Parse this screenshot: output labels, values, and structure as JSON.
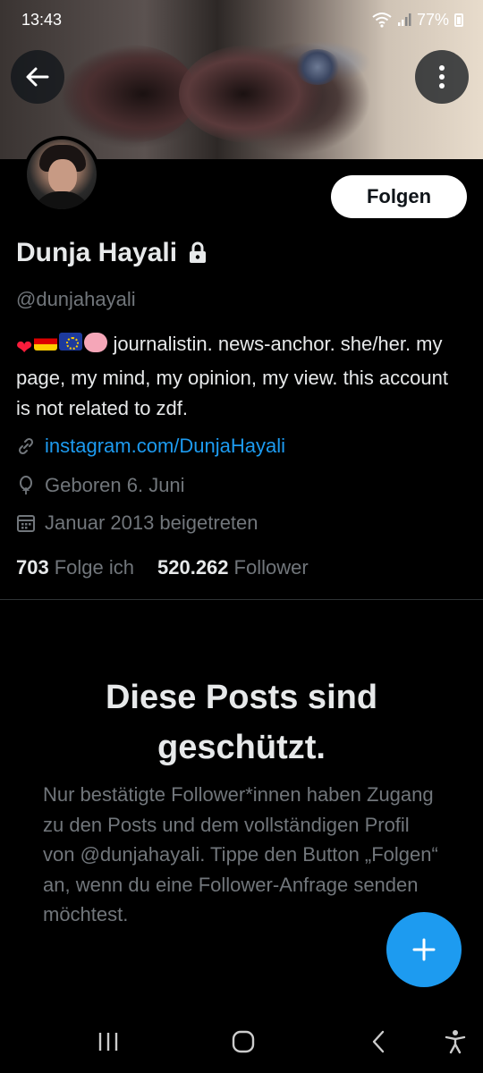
{
  "status_bar": {
    "time": "13:43",
    "battery": "77%",
    "icons": [
      "wifi-icon",
      "signal-icon",
      "battery-icon"
    ]
  },
  "profile": {
    "display_name": "Dunja Hayali",
    "handle": "@dunjahayali",
    "bio_emojis": [
      "heart-emoji",
      "germany-flag-emoji",
      "eu-flag-emoji",
      "brain-emoji"
    ],
    "bio_text": "journalistin. news-anchor. she/her. my page, my mind, my opinion, my view. this account is not related to zdf.",
    "link": "instagram.com/DunjaHayali",
    "birthday": "Geboren 6. Juni",
    "joined": "Januar 2013 beigetreten",
    "following_count": "703",
    "following_label": "Folge ich",
    "followers_count": "520.262",
    "followers_label": "Follower",
    "protected": true
  },
  "buttons": {
    "follow_label": "Folgen"
  },
  "protected_notice": {
    "title": "Diese Posts sind geschützt.",
    "body": "Nur bestätigte Follower*innen haben Zugang zu den Posts und dem vollständigen Profil von @dunjahayali. Tippe den Button „Folgen“ an, wenn du eine Follower-Anfrage senden möchtest."
  },
  "colors": {
    "background": "#000000",
    "accent": "#1d9bf0",
    "text_primary": "#e7e9ea",
    "text_secondary": "#71767b",
    "divider": "#2f3336"
  }
}
